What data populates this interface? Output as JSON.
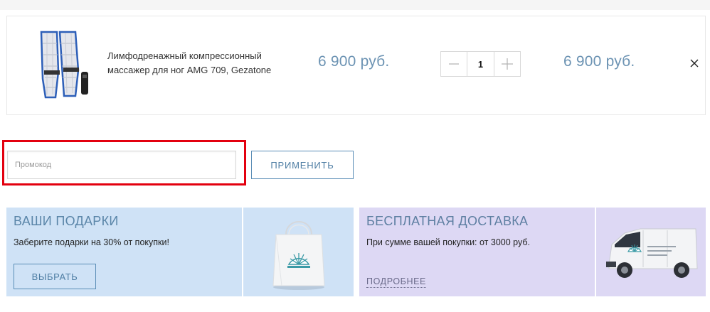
{
  "cart": {
    "item": {
      "name": "Лимфодренажный компрессионный массажер для ног AMG 709, Gezatone",
      "unit_price": "6 900 руб.",
      "quantity": "1",
      "total_price": "6 900 руб.",
      "image_icon": "leg-massager-image",
      "remove_icon": "close-icon"
    }
  },
  "promo": {
    "placeholder": "Промокод",
    "value": "",
    "apply_label": "ПРИМЕНИТЬ",
    "highlight_color": "#e3000f"
  },
  "gifts": {
    "title": "ВАШИ ПОДАРКИ",
    "text": "Заберите подарки на 30% от покупки!",
    "button_label": "ВЫБРАТЬ",
    "image_icon": "gift-bag-image",
    "background": "#cfe2f6"
  },
  "delivery": {
    "title": "БЕСПЛАТНАЯ ДОСТАВКА",
    "text": "При сумме вашей покупки: от 3000 руб.",
    "link_label": "ПОДРОБНЕЕ",
    "image_icon": "delivery-van-image",
    "background": "#ddd8f4"
  },
  "colors": {
    "accent": "#5a8db6",
    "price": "#6c93b3"
  }
}
